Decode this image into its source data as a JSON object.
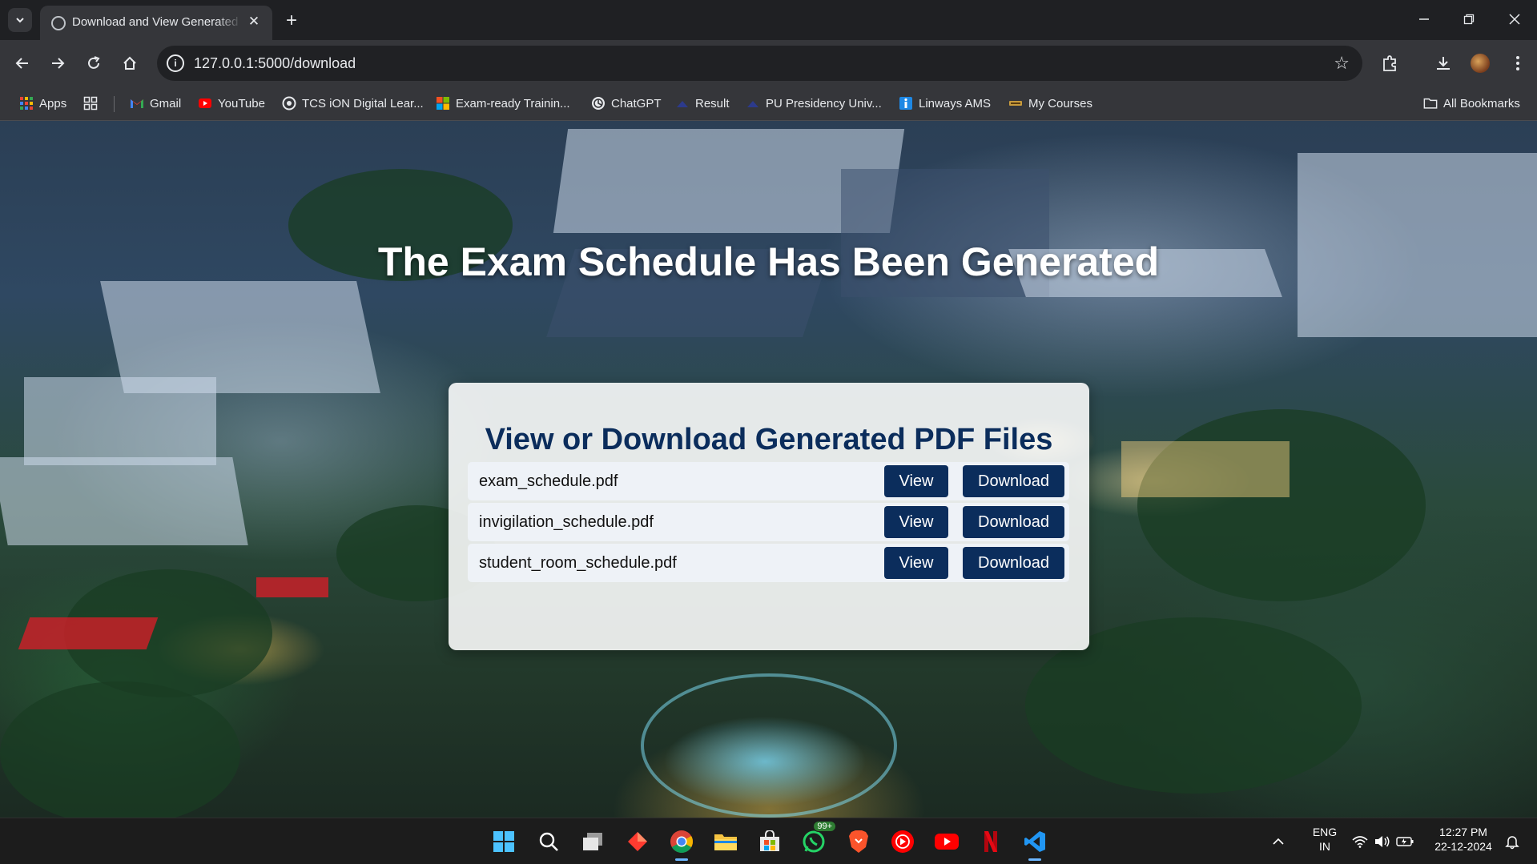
{
  "browser": {
    "tab_title": "Download and View Generated PDFs",
    "url": "127.0.0.1:5000/download",
    "bookmarks": [
      {
        "label": "Apps",
        "icon": "apps-grid-icon"
      },
      {
        "label": "Gmail",
        "icon": "gmail-icon"
      },
      {
        "label": "YouTube",
        "icon": "youtube-icon"
      },
      {
        "label": "TCS iON Digital Lear...",
        "icon": "tcs-ion-icon"
      },
      {
        "label": "Exam-ready Trainin...",
        "icon": "microsoft-icon"
      },
      {
        "label": "ChatGPT",
        "icon": "chatgpt-icon"
      },
      {
        "label": "Result",
        "icon": "folder-shape-icon"
      },
      {
        "label": "PU Presidency Univ...",
        "icon": "folder-shape-icon"
      },
      {
        "label": "Linways AMS",
        "icon": "linways-icon"
      },
      {
        "label": "My Courses",
        "icon": "courses-icon"
      }
    ],
    "all_bookmarks_label": "All Bookmarks"
  },
  "page": {
    "heading": "The Exam Schedule Has Been Generated",
    "card_title": "View or Download Generated PDF Files",
    "files": [
      {
        "name": "exam_schedule.pdf",
        "view_label": "View",
        "download_label": "Download"
      },
      {
        "name": "invigilation_schedule.pdf",
        "view_label": "View",
        "download_label": "Download"
      },
      {
        "name": "student_room_schedule.pdf",
        "view_label": "View",
        "download_label": "Download"
      }
    ],
    "colors": {
      "accent": "#0b2d5c",
      "heading": "#ffffff"
    }
  },
  "taskbar": {
    "apps": [
      "windows-start-icon",
      "search-icon",
      "task-view-icon",
      "app-diamond-icon",
      "chrome-icon",
      "file-explorer-icon",
      "microsoft-store-icon",
      "whatsapp-icon",
      "brave-icon",
      "youtube-music-icon",
      "youtube-icon",
      "netflix-icon",
      "vscode-icon"
    ],
    "whatsapp_badge": "99+",
    "language_top": "ENG",
    "language_bottom": "IN",
    "time": "12:27 PM",
    "date": "22-12-2024"
  }
}
